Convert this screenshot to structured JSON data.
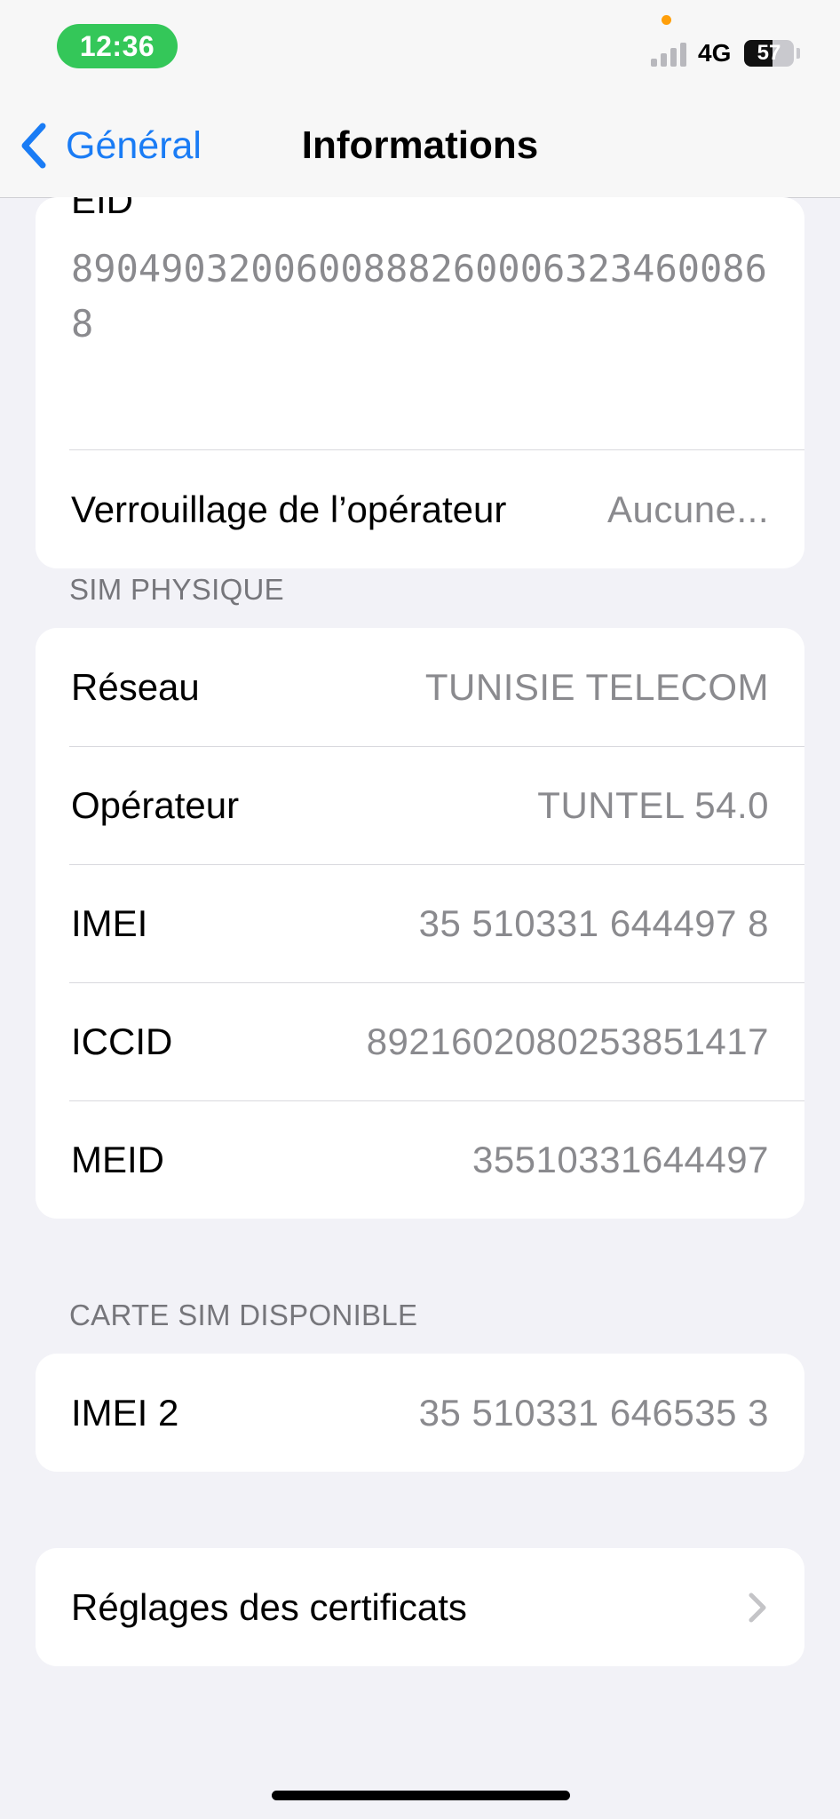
{
  "status_bar": {
    "time": "12:36",
    "network": "4G",
    "battery_level": 57,
    "battery_text": "57"
  },
  "nav": {
    "back_label": "Général",
    "title": "Informations"
  },
  "top_group": {
    "eid_label": "EID",
    "eid_value": "89049032006008882600063234600868",
    "carrier_lock_label": "Verrouillage de l’opérateur",
    "carrier_lock_value": "Aucune..."
  },
  "sim_physique": {
    "header": "SIM PHYSIQUE",
    "rows": [
      {
        "label": "Réseau",
        "value": "TUNISIE TELECOM"
      },
      {
        "label": "Opérateur",
        "value": "TUNTEL 54.0"
      },
      {
        "label": "IMEI",
        "value": "35 510331 644497 8"
      },
      {
        "label": "ICCID",
        "value": "8921602080253851417"
      },
      {
        "label": "MEID",
        "value": "35510331644497"
      }
    ]
  },
  "carte_sim": {
    "header": "CARTE SIM DISPONIBLE",
    "rows": [
      {
        "label": "IMEI 2",
        "value": "35 510331 646535 3"
      }
    ]
  },
  "certificates": {
    "label": "Réglages des certificats"
  },
  "colors": {
    "accent": "#1a7cf5",
    "time_pill": "#34c759",
    "background": "#f2f2f7"
  }
}
